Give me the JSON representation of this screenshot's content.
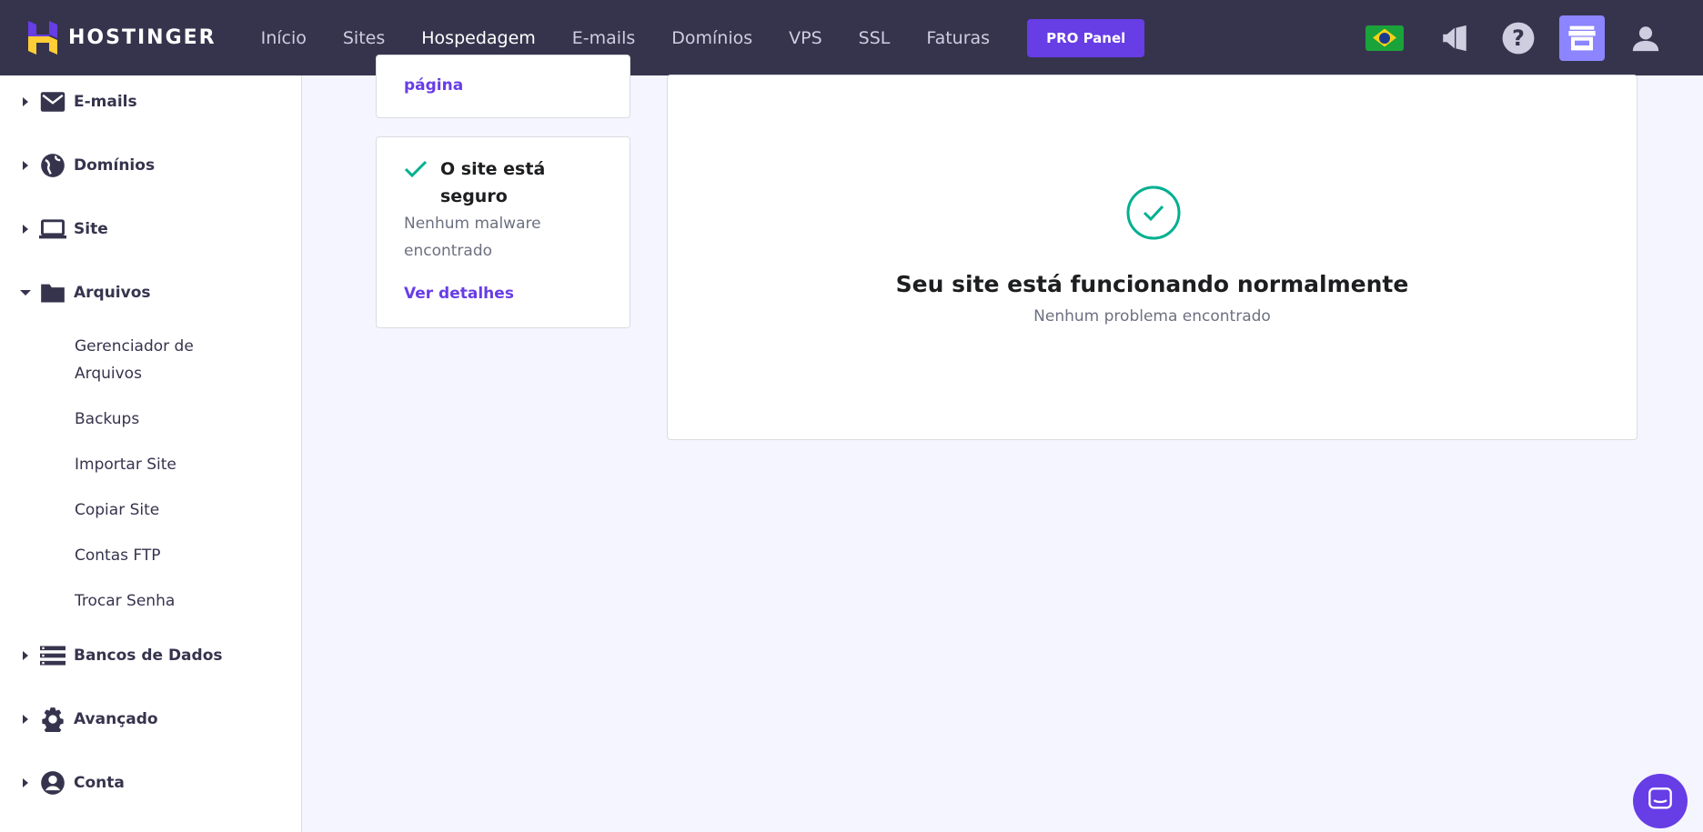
{
  "brand": {
    "name": "HOSTINGER"
  },
  "topnav": {
    "items": [
      {
        "label": "Início"
      },
      {
        "label": "Sites"
      },
      {
        "label": "Hospedagem"
      },
      {
        "label": "E-mails"
      },
      {
        "label": "Domínios"
      },
      {
        "label": "VPS"
      },
      {
        "label": "SSL"
      },
      {
        "label": "Faturas"
      }
    ],
    "pro_button": "PRO Panel",
    "icons": [
      "brazil-flag-icon",
      "megaphone-icon",
      "help-icon",
      "store-icon",
      "account-icon"
    ]
  },
  "sidebar": {
    "sections": [
      {
        "label": "E-mails",
        "icon": "mail-icon",
        "expanded": false
      },
      {
        "label": "Domínios",
        "icon": "globe-icon",
        "expanded": false
      },
      {
        "label": "Site",
        "icon": "laptop-icon",
        "expanded": false
      },
      {
        "label": "Arquivos",
        "icon": "folder-icon",
        "expanded": true
      },
      {
        "label": "Bancos de Dados",
        "icon": "database-icon",
        "expanded": false
      },
      {
        "label": "Avançado",
        "icon": "gear-icon",
        "expanded": false
      },
      {
        "label": "Conta",
        "icon": "user-circle-icon",
        "expanded": false
      }
    ],
    "arquivos_items": [
      {
        "label": "Gerenciador de"
      },
      {
        "label": "Arquivos"
      },
      {
        "label": "Backups"
      },
      {
        "label": "Importar Site"
      },
      {
        "label": "Copiar Site"
      },
      {
        "label": "Contas FTP"
      },
      {
        "label": "Trocar Senha"
      }
    ]
  },
  "cards": {
    "partial_link": "página",
    "secure": {
      "title_line1": "O site está",
      "title_line2": "seguro",
      "desc_line1": "Nenhum malware",
      "desc_line2": "encontrado",
      "link": "Ver detalhes"
    },
    "status": {
      "title": "Seu site está funcionando normalmente",
      "subtitle": "Nenhum problema encontrado"
    }
  },
  "colors": {
    "topbar": "#36344d",
    "accent": "#673de6",
    "success": "#00b090"
  }
}
